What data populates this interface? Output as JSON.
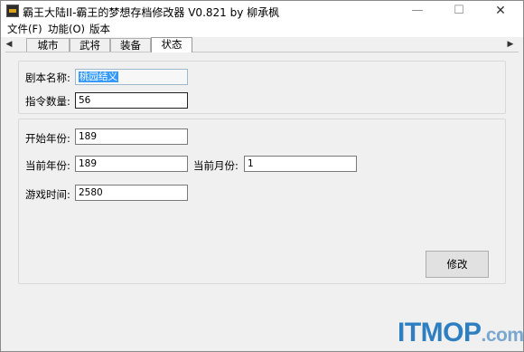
{
  "window": {
    "title": "霸王大陆II-霸王的梦想存档修改器 V0.821 by 柳承枫",
    "controls": {
      "minimize": "—",
      "maximize": "☐",
      "close": "✕"
    }
  },
  "menu": [
    {
      "label": "文件(F)"
    },
    {
      "label": "功能(O)"
    },
    {
      "label": "版本"
    }
  ],
  "tabs": {
    "scroll_left": "◀",
    "scroll_right": "▶",
    "items": [
      {
        "label": "城市",
        "active": false
      },
      {
        "label": "武将",
        "active": false
      },
      {
        "label": "装备",
        "active": false
      },
      {
        "label": "状态",
        "active": true
      }
    ]
  },
  "script_info": {
    "name_label": "剧本名称:",
    "name_value": "桃园结义",
    "count_label": "指令数量:",
    "count_value": "56"
  },
  "status": {
    "start_year_label": "开始年份:",
    "start_year_value": "189",
    "current_year_label": "当前年份:",
    "current_year_value": "189",
    "current_month_label": "当前月份:",
    "current_month_value": "1",
    "play_time_label": "游戏时间:",
    "play_time_value": "2580"
  },
  "actions": {
    "modify_label": "修改"
  },
  "watermark": {
    "main": "ITMOP",
    "suffix": ".com"
  },
  "colors": {
    "selection": "#3399ff",
    "watermark": "#2e7fc1"
  }
}
